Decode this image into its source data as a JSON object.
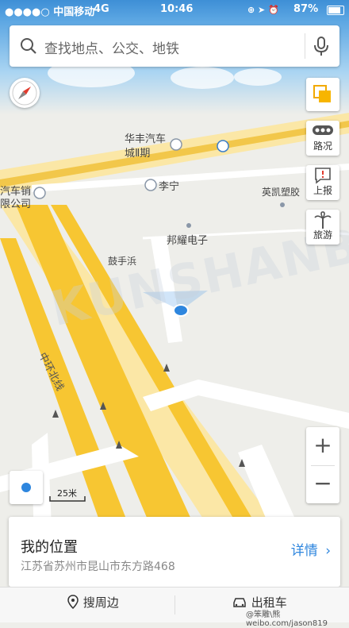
{
  "status_bar": {
    "carrier": "●●●●○ 中国移动",
    "network": "4G",
    "time": "10:46",
    "battery": "87%"
  },
  "search": {
    "placeholder": "查找地点、公交、地铁",
    "icon": "search-icon",
    "mic_icon": "microphone-icon"
  },
  "map": {
    "labels": {
      "huafeng": "华丰汽车",
      "chengii": "城Ⅱ期",
      "lining": "李宁",
      "yingkai": "英凯塑胶",
      "bangyao": "邦耀电子",
      "gushoubang": "鼓手浜",
      "car_sales_1": "汽车销",
      "car_sales_2": "限公司",
      "zhonghuan": "中环北线"
    },
    "watermark": "KUNSHANBBS"
  },
  "side_controls": [
    {
      "label": "",
      "icon": "layers-icon"
    },
    {
      "label": "路况",
      "icon": "traffic-icon"
    },
    {
      "label": "上报",
      "icon": "report-icon"
    },
    {
      "label": "旅游",
      "icon": "palm-tree-icon"
    }
  ],
  "scale": "25米",
  "zoom": {
    "in": "+",
    "out": "−"
  },
  "location_card": {
    "title": "我的位置",
    "address": "江苏省苏州市昆山市东方路468",
    "details": "详情"
  },
  "bottom_bar": {
    "nearby": "搜周边",
    "taxi": "出租车"
  },
  "credit": "@笨雕\\熊  weibo.com/jason819",
  "colors": {
    "accent": "#2e86de",
    "road_main": "#f7c632",
    "status_bar": "#3e8fd6"
  }
}
